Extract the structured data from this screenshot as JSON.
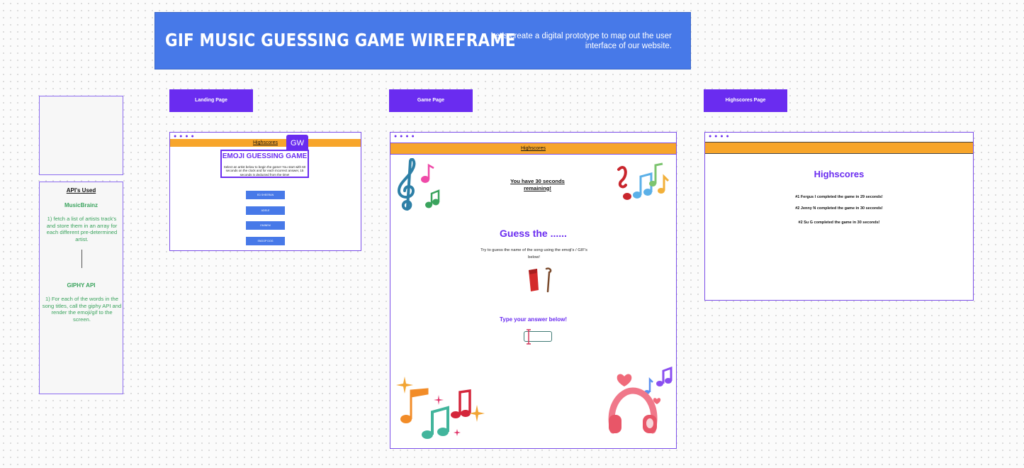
{
  "banner": {
    "title": "GIF MUSIC GUESSING GAME WIREFRAME",
    "subtitle": "Let's create a digital prototype to map out the user interface of our website."
  },
  "apis": {
    "heading": "API's Used",
    "musicbrainz_name": "MusicBrainz",
    "musicbrainz_desc": "1) fetch a list of artists track's and store them in an array for each different pre-determined artist.",
    "giphy_name": "GIPHY API",
    "giphy_desc": "1) For each of the words in the song titles, call the giphy API and render the emoji/gif to the screen."
  },
  "tabs": {
    "landing": "Landing Page",
    "game": "Game Page",
    "highscores": "Highscores Page"
  },
  "window_dots": "● ● ● ●",
  "landing": {
    "nav_link": "Highscores",
    "badge": "GW",
    "title": "EMOJI GUESSING GAME",
    "intro": "Select an artist below to begin the game! You start with 60 seconds on the clock and for each incorrect answer, 15 seconds is deducted from the time!",
    "artists": [
      "ED SHEERAN",
      "ADELE",
      "EMINEM",
      "SNOOP DOG"
    ]
  },
  "game": {
    "nav_link": "Highscores",
    "timer": "You have 30 seconds remaining!",
    "guess_title": "Guess the ......",
    "guess_desc": "Try to guess the name of the song using the emoji's / GIF's below!",
    "answer_title": "Type your answer below!"
  },
  "highscores": {
    "title": "Highscores",
    "scores": [
      "#1 Fergus I completed the  game in 29 seconds!",
      "#2 Jenny N completed the  game in 30 seconds!",
      "#2 Su G completed the  game in 30 seconds!"
    ]
  },
  "colors": {
    "banner": "#4779e8",
    "accent_purple": "#6a2cf0",
    "navbar_orange": "#f7a52a",
    "api_green": "#3aa35d"
  }
}
